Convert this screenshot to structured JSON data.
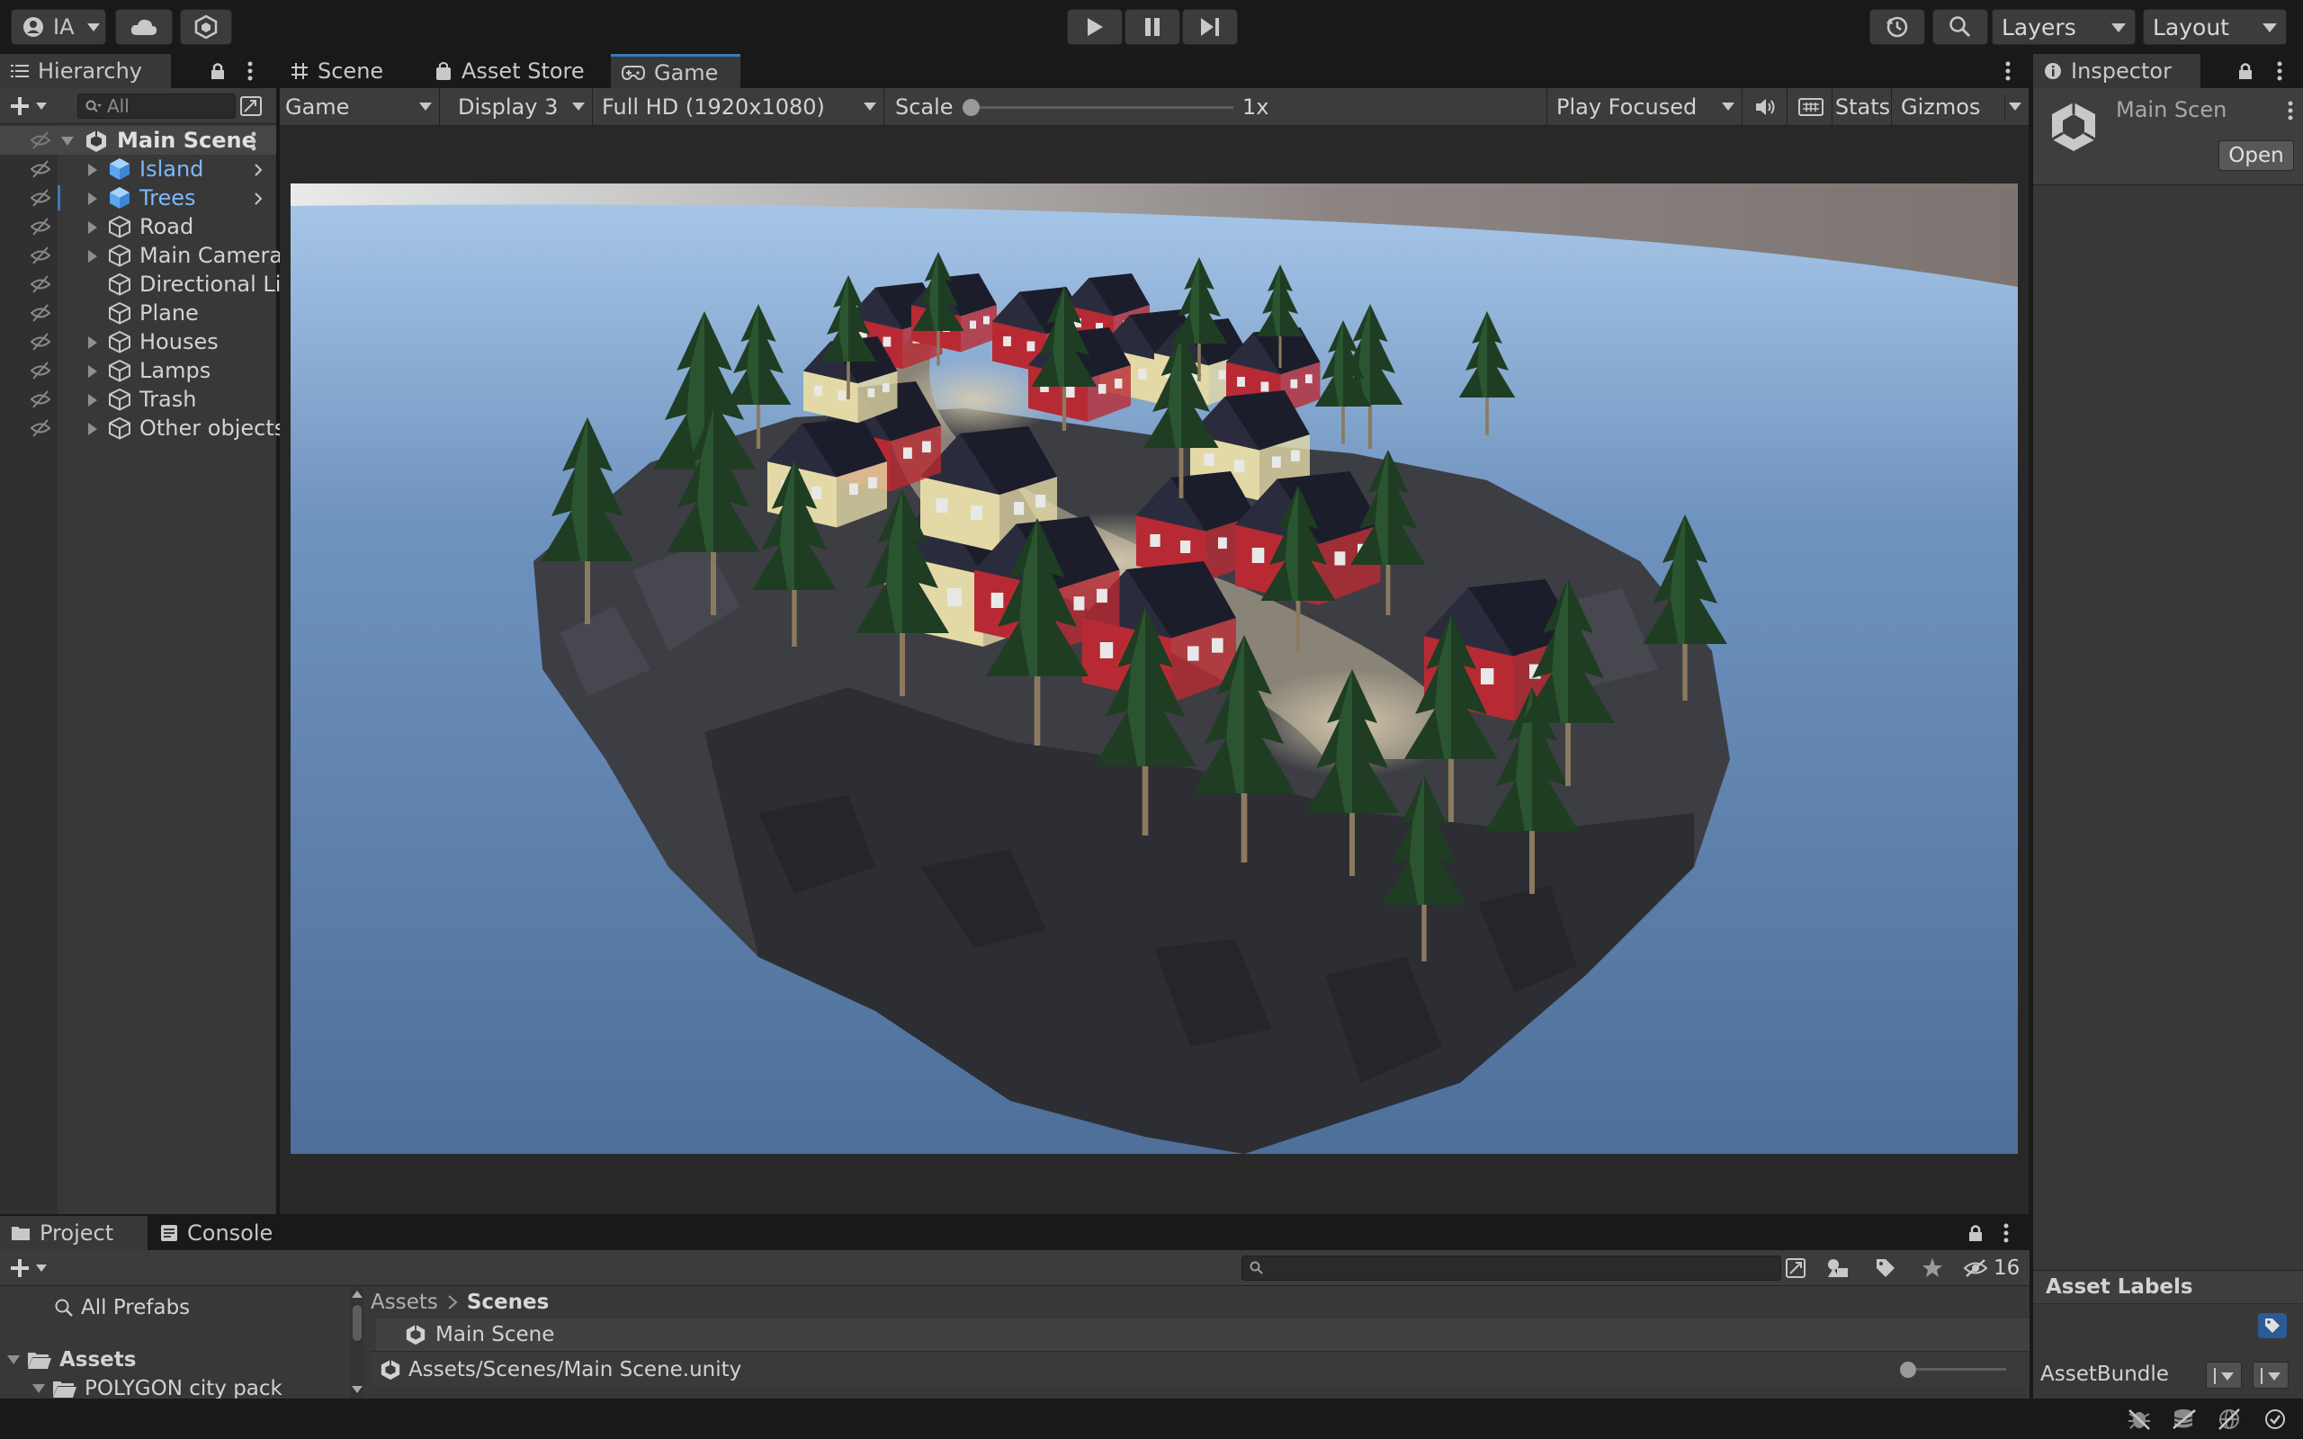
{
  "toolbar": {
    "account_label": "IA",
    "layers_label": "Layers",
    "layout_label": "Layout"
  },
  "hierarchy": {
    "tab_label": "Hierarchy",
    "search_placeholder": "All",
    "scene_name": "Main Scene",
    "items": [
      {
        "label": "Island",
        "has_children": true,
        "prefab": true
      },
      {
        "label": "Trees",
        "has_children": true,
        "prefab": true
      },
      {
        "label": "Road",
        "has_children": true,
        "prefab": false
      },
      {
        "label": "Main Camera",
        "has_children": true,
        "prefab": false
      },
      {
        "label": "Directional Li",
        "has_children": false,
        "prefab": false
      },
      {
        "label": "Plane",
        "has_children": false,
        "prefab": false
      },
      {
        "label": "Houses",
        "has_children": true,
        "prefab": false
      },
      {
        "label": "Lamps",
        "has_children": true,
        "prefab": false
      },
      {
        "label": "Trash",
        "has_children": true,
        "prefab": false
      },
      {
        "label": "Other objects",
        "has_children": true,
        "prefab": false
      }
    ]
  },
  "center_tabs": {
    "scene": "Scene",
    "asset_store": "Asset Store",
    "game": "Game"
  },
  "game_bar": {
    "view_mode": "Game",
    "display": "Display 3",
    "resolution": "Full HD (1920x1080)",
    "scale_label": "Scale",
    "scale_value": "1x",
    "play_mode": "Play Focused",
    "stats": "Stats",
    "gizmos": "Gizmos"
  },
  "inspector": {
    "tab_label": "Inspector",
    "object_name": "Main Scen",
    "open_button": "Open",
    "asset_labels": "Asset Labels",
    "asset_bundle": "AssetBundle"
  },
  "project": {
    "tab_project": "Project",
    "tab_console": "Console",
    "hidden_count": "16",
    "all_prefabs": "All Prefabs",
    "assets_root": "Assets",
    "polygon_folder": "POLYGON city pack",
    "breadcrumb_root": "Assets",
    "breadcrumb_current": "Scenes",
    "file_name": "Main Scene",
    "selected_path": "Assets/Scenes/Main Scene.unity"
  },
  "colors": {
    "accent_blue": "#3a79bb",
    "prefab_blue": "#7cb9ff",
    "panel_bg": "#383838",
    "toolbar_bg": "#191919",
    "sky_blue": "#5a80ab",
    "house_red": "#b82a33"
  }
}
